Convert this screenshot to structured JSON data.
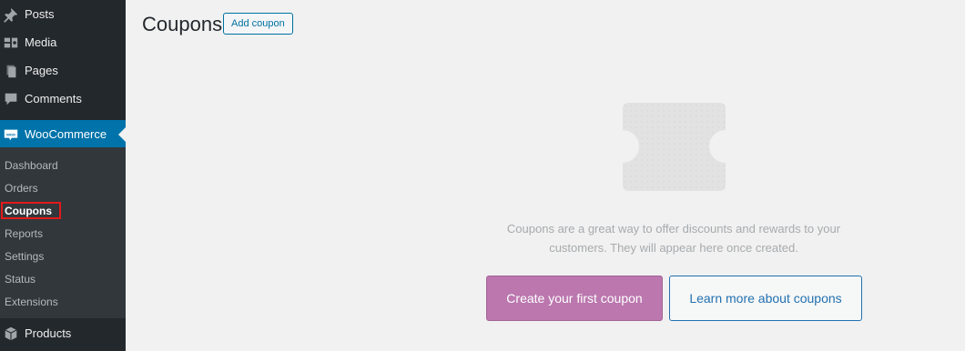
{
  "sidebar": {
    "items": [
      {
        "label": "Posts",
        "icon": "pin-icon"
      },
      {
        "label": "Media",
        "icon": "media-icon"
      },
      {
        "label": "Pages",
        "icon": "pages-icon"
      },
      {
        "label": "Comments",
        "icon": "comment-icon"
      },
      {
        "label": "WooCommerce",
        "icon": "woocommerce-icon",
        "active": true
      },
      {
        "label": "Products",
        "icon": "products-icon"
      }
    ],
    "woocommerce_submenu": [
      {
        "label": "Dashboard"
      },
      {
        "label": "Orders"
      },
      {
        "label": "Coupons",
        "current": true
      },
      {
        "label": "Reports"
      },
      {
        "label": "Settings"
      },
      {
        "label": "Status"
      },
      {
        "label": "Extensions"
      }
    ],
    "woo_badge": "woo"
  },
  "header": {
    "title": "Coupons",
    "add_button": "Add coupon"
  },
  "empty_state": {
    "line1": "Coupons are a great way to offer discounts and rewards to your",
    "line2": "customers. They will appear here once created.",
    "primary_button": "Create your first coupon",
    "secondary_button": "Learn more about coupons"
  },
  "colors": {
    "sidebar_bg": "#23282d",
    "submenu_bg": "#32373c",
    "active_bg": "#0073aa",
    "accent_purple": "#bb77ae",
    "link_blue": "#2271b1",
    "highlight_red": "#e21a1a"
  }
}
